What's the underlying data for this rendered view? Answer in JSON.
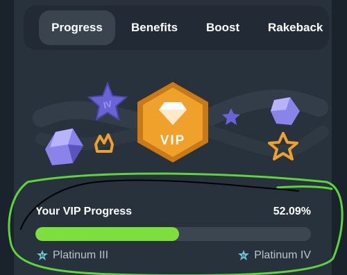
{
  "tabs": [
    {
      "label": "Progress",
      "active": true
    },
    {
      "label": "Benefits",
      "active": false
    },
    {
      "label": "Boost",
      "active": false
    },
    {
      "label": "Rakeback",
      "active": false
    }
  ],
  "hero": {
    "badge_text": "VIP",
    "star_badge_text": "IV"
  },
  "progress": {
    "label": "Your VIP Progress",
    "value_text": "52.09%",
    "percent": 52.09
  },
  "levels": {
    "current": {
      "label": "Platinum III",
      "icon": "platinum-3-badge-icon",
      "icon_text": "III"
    },
    "next": {
      "label": "Platinum IV",
      "icon": "platinum-4-badge-icon",
      "icon_text": "IV"
    }
  },
  "colors": {
    "accent_green": "#7ddf3c",
    "badge_orange": "#f0a12b",
    "annotation_green": "#5cd638"
  }
}
